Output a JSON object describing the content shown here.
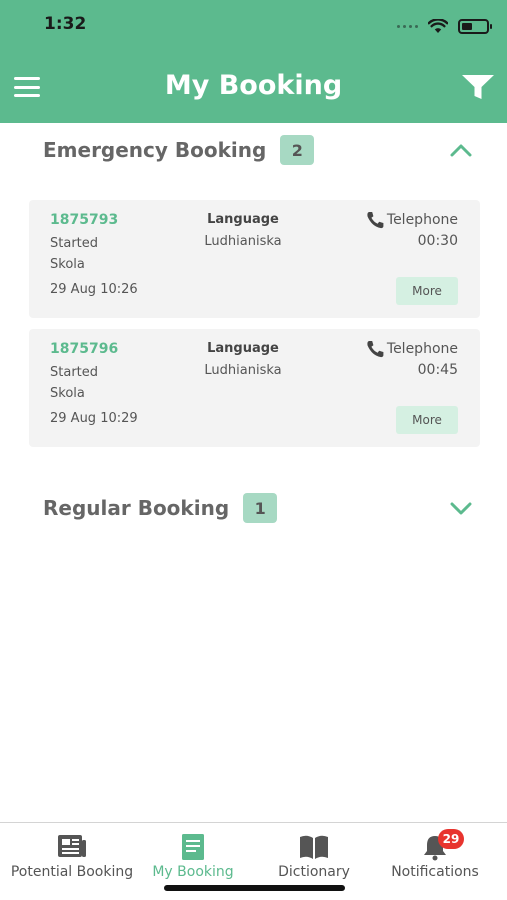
{
  "status_bar": {
    "time": "1:32"
  },
  "header": {
    "title": "My Booking"
  },
  "emergency": {
    "title": "Emergency Booking",
    "count": "2",
    "bookings": [
      {
        "id": "1875793",
        "status": "Started",
        "place": "Skola",
        "datetime": "29 Aug 10:26",
        "language_label": "Language",
        "language": "Ludhianiska",
        "type": "Telephone",
        "duration": "00:30",
        "more_label": "More"
      },
      {
        "id": "1875796",
        "status": "Started",
        "place": "Skola",
        "datetime": "29 Aug 10:29",
        "language_label": "Language",
        "language": "Ludhianiska",
        "type": "Telephone",
        "duration": "00:45",
        "more_label": "More"
      }
    ]
  },
  "regular": {
    "title": "Regular Booking",
    "count": "1"
  },
  "tabs": [
    {
      "label": "Potential Booking",
      "icon": "newspaper-icon"
    },
    {
      "label": "My Booking",
      "icon": "document-icon",
      "active": true
    },
    {
      "label": "Dictionary",
      "icon": "book-icon"
    },
    {
      "label": "Notifications",
      "icon": "bell-icon",
      "badge": "29"
    }
  ],
  "colors": {
    "accent": "#5cba8e",
    "badge": "#a7d9c3",
    "card": "#f3f3f3",
    "more_button": "#d5f0e2",
    "notification_badge": "#e8342e"
  }
}
